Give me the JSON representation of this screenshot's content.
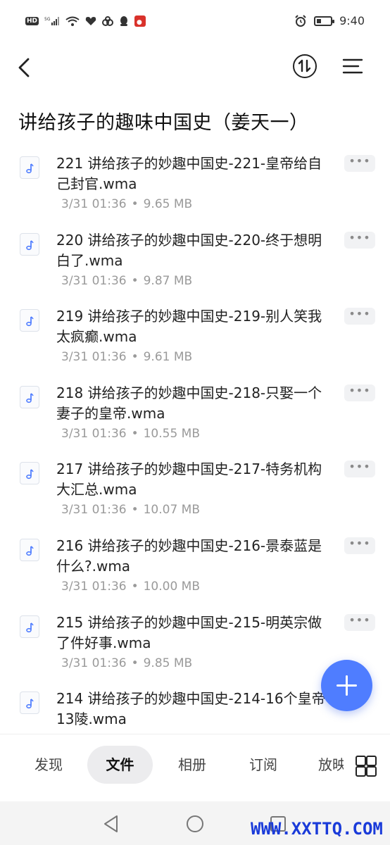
{
  "status_bar": {
    "left_icons": [
      "hd-icon",
      "signal-5g-icon",
      "wifi-icon",
      "heart-icon",
      "cloud-app-icon",
      "qq-icon",
      "app-icon"
    ],
    "hd_label": "HD",
    "time": "9:40",
    "right_icons": [
      "alarm-icon",
      "battery-icon"
    ]
  },
  "page": {
    "title": "讲给孩子的趣味中国史（姜天一）"
  },
  "files": [
    {
      "name": "221 讲给孩子的妙趣中国史-221-皇帝给自己封官.wma",
      "date": "3/31 01:36",
      "size": "9.65 MB"
    },
    {
      "name": "220 讲给孩子的妙趣中国史-220-终于想明白了.wma",
      "date": "3/31 01:36",
      "size": "9.87 MB"
    },
    {
      "name": "219 讲给孩子的妙趣中国史-219-别人笑我太疯癫.wma",
      "date": "3/31 01:36",
      "size": "9.61 MB"
    },
    {
      "name": "218 讲给孩子的妙趣中国史-218-只娶一个妻子的皇帝.wma",
      "date": "3/31 01:36",
      "size": "10.55 MB"
    },
    {
      "name": "217 讲给孩子的妙趣中国史-217-特务机构大汇总.wma",
      "date": "3/31 01:36",
      "size": "10.07 MB"
    },
    {
      "name": "216 讲给孩子的妙趣中国史-216-景泰蓝是什么?.wma",
      "date": "3/31 01:36",
      "size": "10.00 MB"
    },
    {
      "name": "215 讲给孩子的妙趣中国史-215-明英宗做了件好事.wma",
      "date": "3/31 01:36",
      "size": "9.85 MB"
    },
    {
      "name": "214 讲给孩子的妙趣中国史-214-16个皇帝13陵.wma",
      "date": "",
      "size": ""
    }
  ],
  "more_label": "•••",
  "tabs": {
    "discover": "发现",
    "files": "文件",
    "album": "相册",
    "subscribe": "订阅",
    "partial": "放映"
  },
  "watermark": "WWW.XXTTQ.COM",
  "colors": {
    "accent": "#4f7dff",
    "watermark": "#1a3bd9"
  }
}
